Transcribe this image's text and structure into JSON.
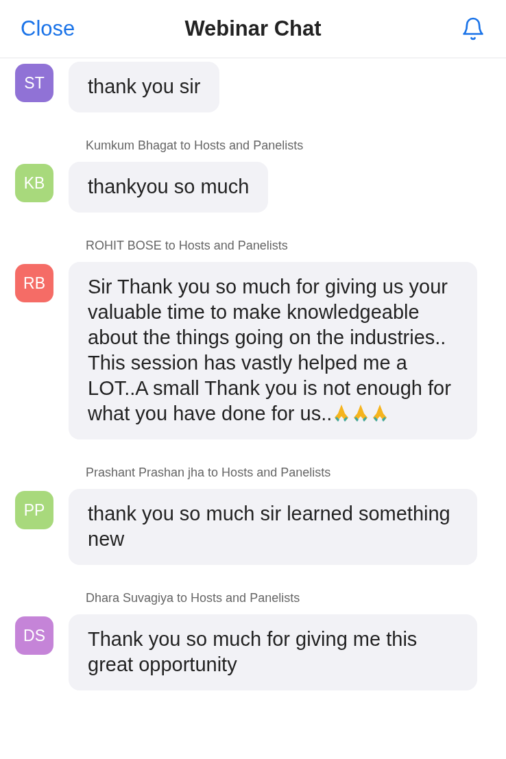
{
  "header": {
    "close": "Close",
    "title": "Webinar Chat"
  },
  "messages": [
    {
      "initials": "ST",
      "color": "#9072d6",
      "text": "thank you sir"
    },
    {
      "sender": "Kumkum Bhagat to Hosts and Panelists",
      "initials": "KB",
      "color": "#a8d97c",
      "text": "thankyou so much"
    },
    {
      "sender": "ROHIT BOSE to Hosts and Panelists",
      "initials": "RB",
      "color": "#f56c66",
      "text": "Sir Thank you so much for giving us your valuable time to make knowledgeable about the things going on the industries.. This session has vastly helped me a LOT..A small Thank you is not enough for what you have done for us..",
      "icons": [
        {
          "kind": "praying-hands"
        },
        {
          "kind": "praying-hands"
        },
        {
          "kind": "praying-hands"
        }
      ]
    },
    {
      "sender": "Prashant Prashan jha to Hosts and Panelists",
      "initials": "PP",
      "color": "#a8d97c",
      "text": "thank you so much sir learned something new"
    },
    {
      "sender": "Dhara Suvagiya to Hosts and Panelists",
      "initials": "DS",
      "color": "#c584d8",
      "text": "Thank you so much for giving me this great opportunity"
    }
  ]
}
